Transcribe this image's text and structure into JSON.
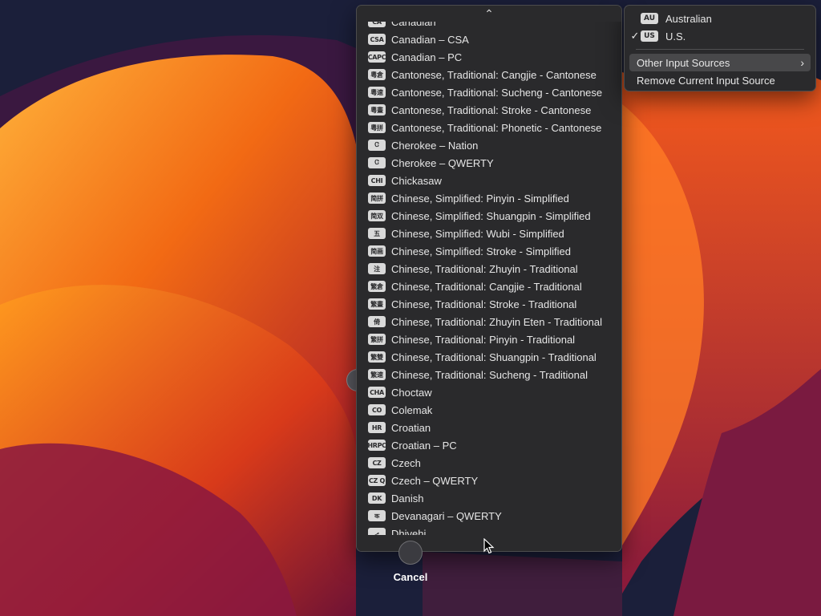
{
  "menus": {
    "input_sources": {
      "scroll_up_glyph": "⌃",
      "items": [
        {
          "badge": "CA",
          "label": "Canadian"
        },
        {
          "badge": "CSA",
          "label": "Canadian – CSA"
        },
        {
          "badge": "CAPC",
          "label": "Canadian – PC"
        },
        {
          "badge": "粵倉",
          "label": "Cantonese, Traditional: Cangjie - Cantonese"
        },
        {
          "badge": "粵速",
          "label": "Cantonese, Traditional: Sucheng - Cantonese"
        },
        {
          "badge": "粵畫",
          "label": "Cantonese, Traditional: Stroke - Cantonese"
        },
        {
          "badge": "粵拼",
          "label": "Cantonese, Traditional: Phonetic - Cantonese"
        },
        {
          "badge": "Ꮳ",
          "label": "Cherokee – Nation"
        },
        {
          "badge": "Ꮳ",
          "label": "Cherokee – QWERTY"
        },
        {
          "badge": "CHI",
          "label": "Chickasaw"
        },
        {
          "badge": "简拼",
          "label": "Chinese, Simplified: Pinyin - Simplified"
        },
        {
          "badge": "简双",
          "label": "Chinese, Simplified: Shuangpin - Simplified"
        },
        {
          "badge": "五",
          "label": "Chinese, Simplified: Wubi - Simplified"
        },
        {
          "badge": "简画",
          "label": "Chinese, Simplified: Stroke - Simplified"
        },
        {
          "badge": "注",
          "label": "Chinese, Traditional: Zhuyin - Traditional"
        },
        {
          "badge": "繁倉",
          "label": "Chinese, Traditional: Cangjie - Traditional"
        },
        {
          "badge": "繁畫",
          "label": "Chinese, Traditional: Stroke - Traditional"
        },
        {
          "badge": "倚",
          "label": "Chinese, Traditional: Zhuyin Eten - Traditional"
        },
        {
          "badge": "繁拼",
          "label": "Chinese, Traditional: Pinyin - Traditional"
        },
        {
          "badge": "繁雙",
          "label": "Chinese, Traditional: Shuangpin - Traditional"
        },
        {
          "badge": "繁速",
          "label": "Chinese, Traditional: Sucheng - Traditional"
        },
        {
          "badge": "CHA",
          "label": "Choctaw"
        },
        {
          "badge": "CO",
          "label": "Colemak"
        },
        {
          "badge": "HR",
          "label": "Croatian"
        },
        {
          "badge": "HRPC",
          "label": "Croatian – PC"
        },
        {
          "badge": "CZ",
          "label": "Czech"
        },
        {
          "badge": "CZ Q",
          "label": "Czech – QWERTY"
        },
        {
          "badge": "DK",
          "label": "Danish"
        },
        {
          "badge": "क",
          "label": "Devanagari – QWERTY"
        },
        {
          "badge": "ދ",
          "label": "Dhivehi"
        }
      ]
    },
    "main": {
      "items": [
        {
          "check": "",
          "badge": "AU",
          "label": "Australian"
        },
        {
          "check": "✓",
          "badge": "US",
          "label": "U.S."
        }
      ],
      "other_sources": {
        "label": "Other Input Sources",
        "chevron": "›"
      },
      "remove": {
        "label": "Remove Current Input Source"
      }
    }
  },
  "cancel": {
    "label": "Cancel"
  },
  "colors": {
    "menu_bg": "#2a2a2c",
    "highlight": "#48484a",
    "text": "#e6e6e6"
  }
}
